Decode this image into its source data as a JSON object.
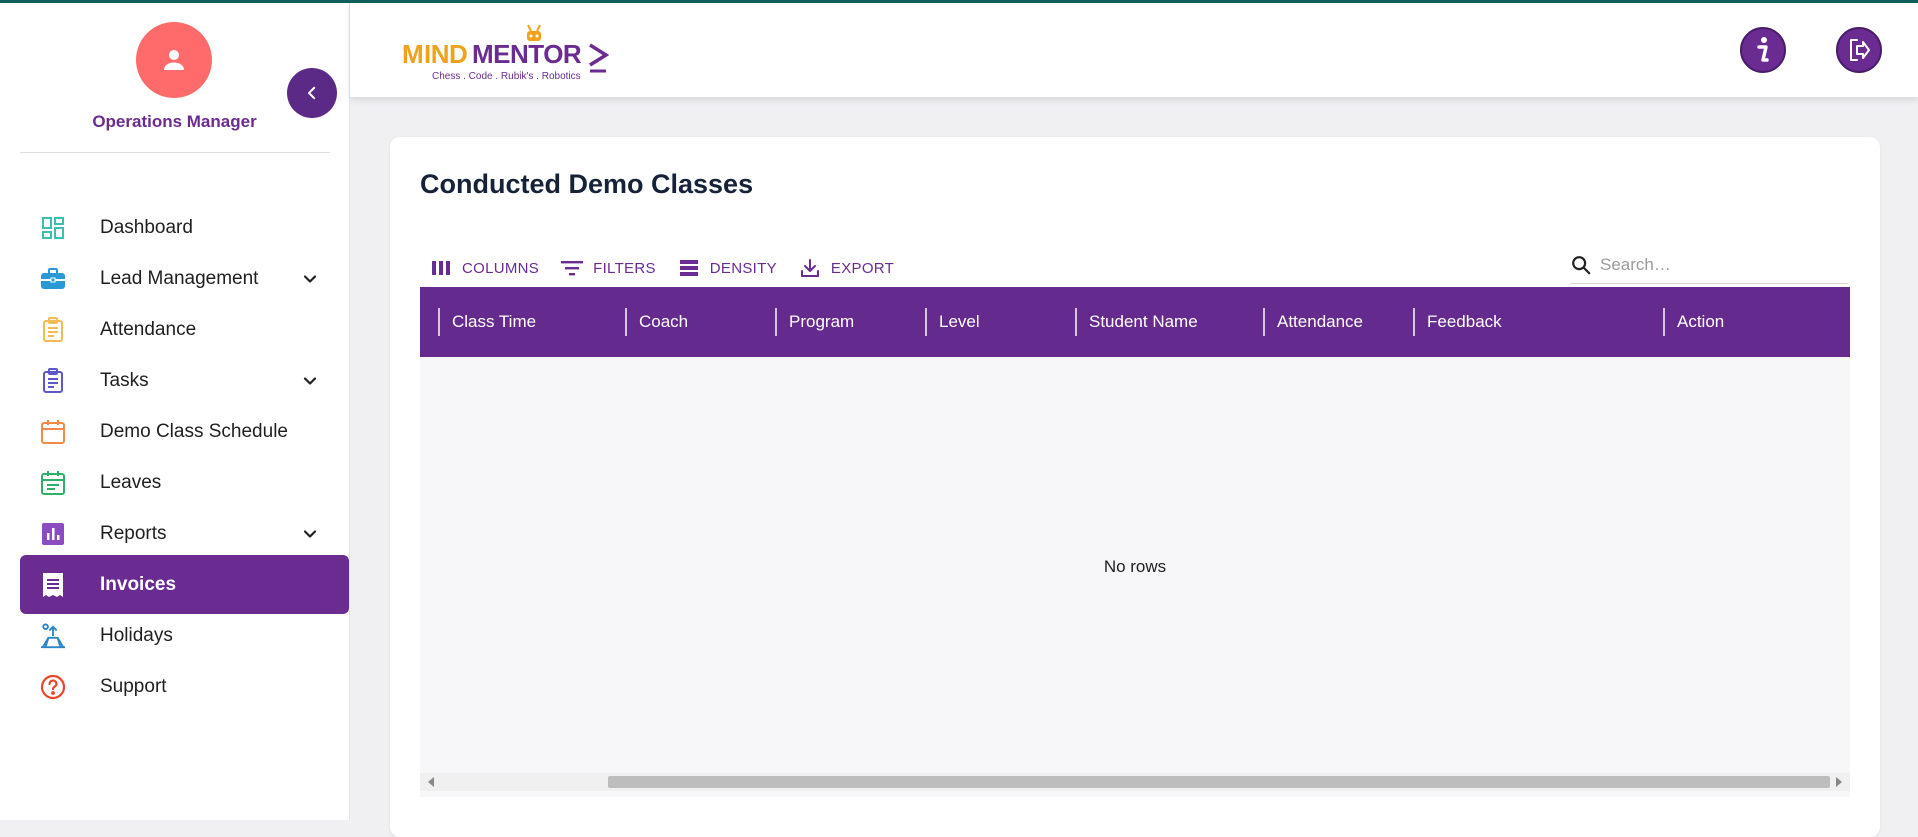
{
  "sidebar": {
    "role": "Operations Manager",
    "items": [
      {
        "label": "Dashboard",
        "icon": "dashboard-icon",
        "expandable": false,
        "active": false
      },
      {
        "label": "Lead Management",
        "icon": "briefcase-icon",
        "expandable": true,
        "active": false
      },
      {
        "label": "Attendance",
        "icon": "clipboard-icon",
        "expandable": false,
        "active": false
      },
      {
        "label": "Tasks",
        "icon": "task-list-icon",
        "expandable": true,
        "active": false
      },
      {
        "label": "Demo Class Schedule",
        "icon": "calendar-icon",
        "expandable": false,
        "active": false
      },
      {
        "label": "Leaves",
        "icon": "calendar-event-icon",
        "expandable": false,
        "active": false
      },
      {
        "label": "Reports",
        "icon": "bar-chart-icon",
        "expandable": true,
        "active": false
      },
      {
        "label": "Invoices",
        "icon": "receipt-icon",
        "expandable": false,
        "active": true
      },
      {
        "label": "Holidays",
        "icon": "beach-icon",
        "expandable": false,
        "active": false
      },
      {
        "label": "Support",
        "icon": "help-circle-icon",
        "expandable": false,
        "active": false
      }
    ]
  },
  "header": {
    "logo_text": "MINDMENTORZ",
    "logo_tagline": "Chess . Code . Rubik's . Robotics"
  },
  "main": {
    "title": "Conducted Demo Classes",
    "toolbar": {
      "columns_label": "COLUMNS",
      "filters_label": "FILTERS",
      "density_label": "DENSITY",
      "export_label": "EXPORT"
    },
    "search": {
      "placeholder": "Search…",
      "value": ""
    },
    "columns": [
      "Class Time",
      "Coach",
      "Program",
      "Level",
      "Student Name",
      "Attendance",
      "Feedback",
      "Action"
    ],
    "empty_text": "No rows"
  },
  "colors": {
    "accent": "#6a2c91",
    "header_bg": "#652a8e",
    "avatar": "#ff6b6b"
  }
}
